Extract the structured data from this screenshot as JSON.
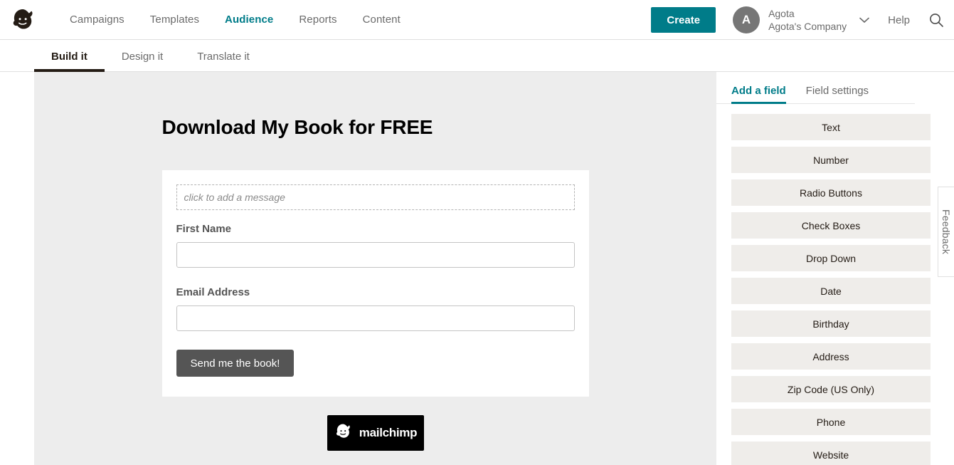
{
  "header": {
    "logo_icon": "mailchimp-logo-icon",
    "nav": [
      {
        "label": "Campaigns",
        "active": false
      },
      {
        "label": "Templates",
        "active": false
      },
      {
        "label": "Audience",
        "active": true
      },
      {
        "label": "Reports",
        "active": false
      },
      {
        "label": "Content",
        "active": false
      }
    ],
    "create_label": "Create",
    "account": {
      "avatar_initial": "A",
      "name": "Agota",
      "organization": "Agota's Company"
    },
    "caret_icon": "chevron-down-icon",
    "help_label": "Help",
    "search_icon": "search-icon"
  },
  "subtabs": [
    {
      "label": "Build it",
      "active": true
    },
    {
      "label": "Design it",
      "active": false
    },
    {
      "label": "Translate it",
      "active": false
    }
  ],
  "preview": {
    "form_title": "Download My Book for FREE",
    "message_placeholder": "click to add a message",
    "fields": [
      {
        "label": "First Name",
        "value": ""
      },
      {
        "label": "Email Address",
        "value": ""
      }
    ],
    "submit_label": "Send me the book!",
    "badge": {
      "icon": "mailchimp-logo-icon",
      "text": "mailchimp"
    }
  },
  "right_panel": {
    "tabs": [
      {
        "label": "Add a field",
        "active": true
      },
      {
        "label": "Field settings",
        "active": false
      }
    ],
    "field_types": [
      "Text",
      "Number",
      "Radio Buttons",
      "Check Boxes",
      "Drop Down",
      "Date",
      "Birthday",
      "Address",
      "Zip Code (US Only)",
      "Phone",
      "Website"
    ]
  },
  "feedback": {
    "label": "Feedback"
  },
  "colors": {
    "accent_teal": "#007c89",
    "canvas_gray": "#ededed",
    "field_button_gray": "#efedea",
    "submit_gray": "#555555",
    "text_dark": "#241c15",
    "text_muted": "#6b6b6b"
  }
}
